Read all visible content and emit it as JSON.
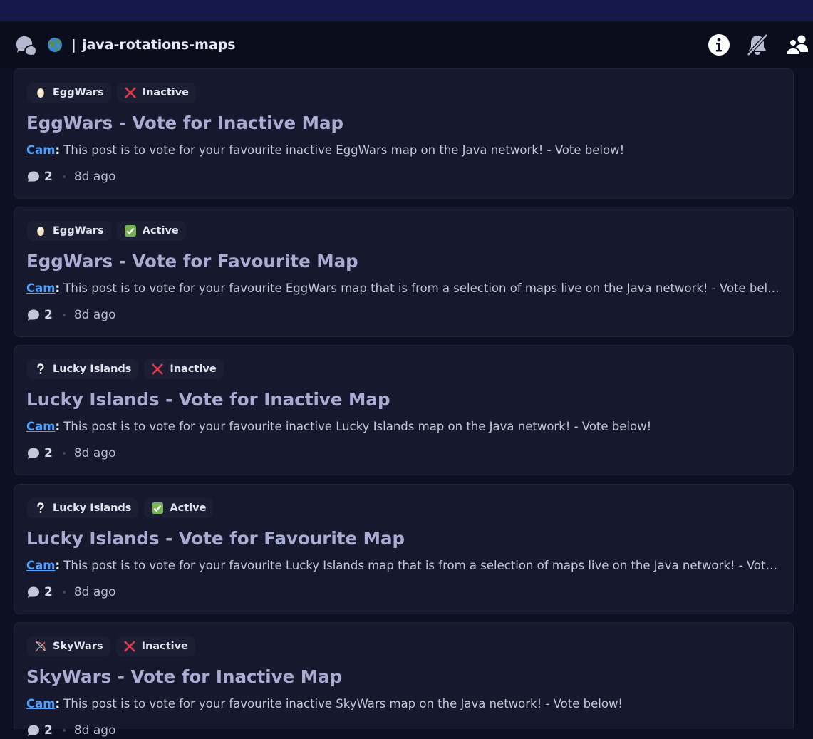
{
  "header": {
    "separator": "|",
    "channel_name": "java-rotations-maps",
    "icons": [
      "forum-icon",
      "globe-icon",
      "info-icon",
      "bell-off-icon",
      "members-icon"
    ]
  },
  "colors": {
    "accent_link": "#4da2ff",
    "inactive_x": "#e3384a",
    "active_check": "#77b255",
    "title": "#a9acd2"
  },
  "posts": [
    {
      "tags": [
        {
          "icon": "egg-icon",
          "label": "EggWars"
        },
        {
          "icon": "cross-mark-icon",
          "label": "Inactive"
        }
      ],
      "title": "EggWars - Vote for Inactive Map",
      "author": "Cam",
      "colon": ":",
      "preview": " This post is to vote for your favourite inactive EggWars map on the Java network! - Vote below!",
      "comment_count": "2",
      "age": "8d ago"
    },
    {
      "tags": [
        {
          "icon": "egg-icon",
          "label": "EggWars"
        },
        {
          "icon": "check-mark-icon",
          "label": "Active"
        }
      ],
      "title": "EggWars - Vote for Favourite Map",
      "author": "Cam",
      "colon": ":",
      "preview": " This post is to vote for your favourite EggWars map that is from a selection of maps live on the Java network! - Vote below!",
      "comment_count": "2",
      "age": "8d ago"
    },
    {
      "tags": [
        {
          "icon": "question-mark-icon",
          "label": "Lucky Islands"
        },
        {
          "icon": "cross-mark-icon",
          "label": "Inactive"
        }
      ],
      "title": "Lucky Islands - Vote for Inactive Map",
      "author": "Cam",
      "colon": ":",
      "preview": " This post is to vote for your favourite inactive Lucky Islands map on the Java network! - Vote below!",
      "comment_count": "2",
      "age": "8d ago"
    },
    {
      "tags": [
        {
          "icon": "question-mark-icon",
          "label": "Lucky Islands"
        },
        {
          "icon": "check-mark-icon",
          "label": "Active"
        }
      ],
      "title": "Lucky Islands - Vote for Favourite Map",
      "author": "Cam",
      "colon": ":",
      "preview": " This post is to vote for your favourite Lucky Islands map that is from a selection of maps live on the Java network! - Vote below!",
      "comment_count": "2",
      "age": "8d ago"
    },
    {
      "tags": [
        {
          "icon": "bow-and-arrow-icon",
          "label": "SkyWars"
        },
        {
          "icon": "cross-mark-icon",
          "label": "Inactive"
        }
      ],
      "title": "SkyWars - Vote for Inactive Map",
      "author": "Cam",
      "colon": ":",
      "preview": " This post is to vote for your favourite inactive SkyWars map on the Java network! - Vote below!",
      "comment_count": "2",
      "age": "8d ago"
    }
  ]
}
